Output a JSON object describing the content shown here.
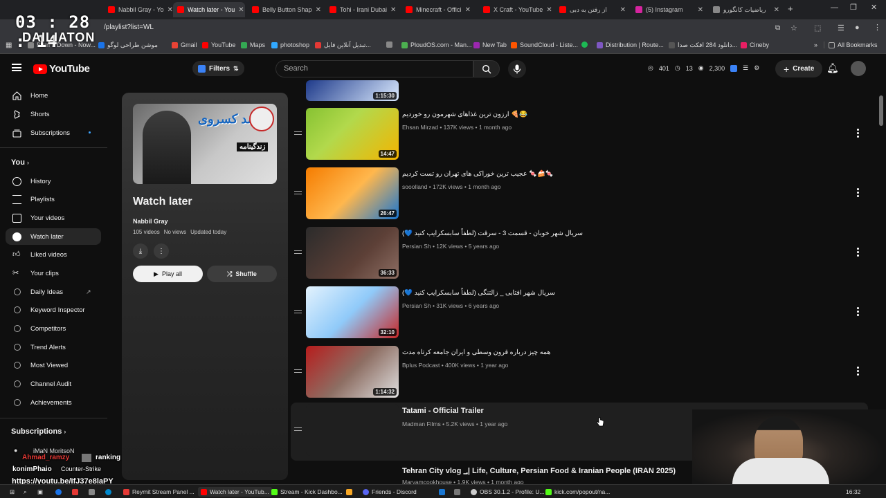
{
  "tabs": [
    {
      "label": "Nabbil Gray - Yo",
      "color": "#ff0000"
    },
    {
      "label": "Watch later - You",
      "color": "#ff0000",
      "active": true
    },
    {
      "label": "Belly Button Shap",
      "color": "#ff0000"
    },
    {
      "label": "Tohi - Irani Dubai",
      "color": "#ff0000"
    },
    {
      "label": "Minecraft - Offici",
      "color": "#ff0000"
    },
    {
      "label": "X Craft - YouTube",
      "color": "#ff0000"
    },
    {
      "label": "از رفتن به دبی",
      "color": "#ff0000"
    },
    {
      "label": "(5) Instagram",
      "color": "#d6249f"
    },
    {
      "label": "ریاضیات کانگورو",
      "color": "#888888"
    }
  ],
  "url": "/playlist?list=WL",
  "bookmarks": [
    {
      "label": "Burn It Down - Now...",
      "color": "#888888"
    },
    {
      "label": "موشن طراحی لوگو",
      "color": "#1a73e8"
    },
    {
      "label": "Gmail",
      "color": "#ea4335"
    },
    {
      "label": "YouTube",
      "color": "#ff0000"
    },
    {
      "label": "Maps",
      "color": "#34a853"
    },
    {
      "label": "photoshop",
      "color": "#31a8ff"
    },
    {
      "label": "تبدیل آنلاین فایل...",
      "color": "#e53935"
    },
    {
      "label": "",
      "color": "#888888"
    },
    {
      "label": "PloudOS.com - Man...",
      "color": "#4caf50"
    },
    {
      "label": "New Tab",
      "color": "#9c27b0"
    },
    {
      "label": "SoundCloud - Liste...",
      "color": "#ff5500"
    },
    {
      "label": "",
      "color": "#1db954"
    },
    {
      "label": "Distribution | Route...",
      "color": "#7e57c2"
    },
    {
      "label": "دانلود 284 افکت صدا...",
      "color": "#555555"
    },
    {
      "label": "Cineby",
      "color": "#e91e63"
    }
  ],
  "all_bookmarks": "All Bookmarks",
  "overlay_timer": {
    "time": "03 : 28 : 14",
    "label": "DAILIATON"
  },
  "header": {
    "logo_text": "YouTube",
    "filters_label": "Filters",
    "search_placeholder": "Search",
    "stats": [
      "401",
      "13",
      "2,300"
    ],
    "create_label": "Create"
  },
  "sidebar": {
    "main": [
      "Home",
      "Shorts",
      "Subscriptions"
    ],
    "you_label": "You",
    "you_items": [
      "History",
      "Playlists",
      "Your videos",
      "Watch later",
      "Liked videos",
      "Your clips"
    ],
    "tools": [
      "Daily Ideas",
      "Keyword Inspector",
      "Competitors",
      "Trend Alerts",
      "Most Viewed",
      "Channel Audit",
      "Achievements"
    ],
    "subscriptions_label": "Subscriptions",
    "sub_item": "iMaN MoritsoN"
  },
  "playlist": {
    "thumb_title": "احمد کسروی",
    "thumb_subtitle": "زندگینامه",
    "title": "Watch later",
    "owner": "Nabbil Gray",
    "video_count": "105 videos",
    "views": "No views",
    "updated": "Updated today",
    "play_all": "Play all",
    "shuffle": "Shuffle"
  },
  "videos": [
    {
      "title": "",
      "meta": "",
      "duration": "1:15:30",
      "thumb_colors": [
        "#1e3a8a",
        "#dbeafe"
      ]
    },
    {
      "title": "ارزون ترین غذاهای شهرمون رو خوردیم 🍕😂",
      "meta": "Ehsan Mirzad • 137K views • 1 month ago",
      "duration": "14:47",
      "thumb_colors": [
        "#86c232",
        "#f4b400"
      ]
    },
    {
      "title": "عجیب ترین خوراکی های تهران رو تست کردیم 🍬🍰🍬",
      "meta": "sooolland • 172K views • 1 month ago",
      "duration": "26:47",
      "thumb_colors": [
        "#f57c00",
        "#1976d2"
      ]
    },
    {
      "title": "سریال شهر خوبان - قسمت 3 - سرقت (لطفاً سابسکرایب کنید 💙)",
      "meta": "Persian Sh • 12K views • 5 years ago",
      "duration": "36:33",
      "thumb_colors": [
        "#2b2b2b",
        "#8d6e63"
      ]
    },
    {
      "title": "سریال شهر افتابی _ زالتنگی (لطفاً سابسکرایب کنید 💙)",
      "meta": "Persian Sh • 31K views • 6 years ago",
      "duration": "32:10",
      "thumb_colors": [
        "#e3f2fd",
        "#c62828"
      ]
    },
    {
      "title": "همه چیز درباره قرون وسطی و ایران جامعه کرتاه مدت",
      "meta": "Bplus Podcast • 400K views • 1 year ago",
      "duration": "1:14:32",
      "thumb_colors": [
        "#b71c1c",
        "#6d4c41"
      ]
    },
    {
      "title": "Tatami - Official Trailer",
      "meta": "Madman Films • 5.2K views • 1 year ago",
      "duration": "",
      "thumb_colors": [
        "#1f1f1f",
        "#1f1f1f"
      ]
    },
    {
      "title": "Tehran City vlog ؀| Life, Culture, Persian Food & Iranian People (IRAN 2025)",
      "meta": "Maryamcookhouse • 1.9K views • 1 month ago",
      "duration": "",
      "thumb_colors": [
        "#0f0f0f",
        "#0f0f0f"
      ]
    }
  ],
  "chat": {
    "line1_user": "Ahmad_ramzy",
    "line1_text": "ranking",
    "line2_user": "konimPhaio",
    "line2_text": "Counter-Strike",
    "link": "https://youtu.be/IfJ37e8laPY"
  },
  "taskbar": [
    {
      "label": "Reymit Stream Panel ...",
      "color": "#e53935"
    },
    {
      "label": "Watch later - YouTub...",
      "color": "#ff0000"
    },
    {
      "label": "Stream - Kick Dashbo...",
      "color": "#53fc18"
    },
    {
      "label": "Friends - Discord",
      "color": "#5865f2"
    },
    {
      "label": "OBS 30.1.2 - Profile: U...",
      "color": "#cccccc"
    },
    {
      "label": "kick.com/popout/na...",
      "color": "#53fc18"
    }
  ],
  "clock": "16:32"
}
